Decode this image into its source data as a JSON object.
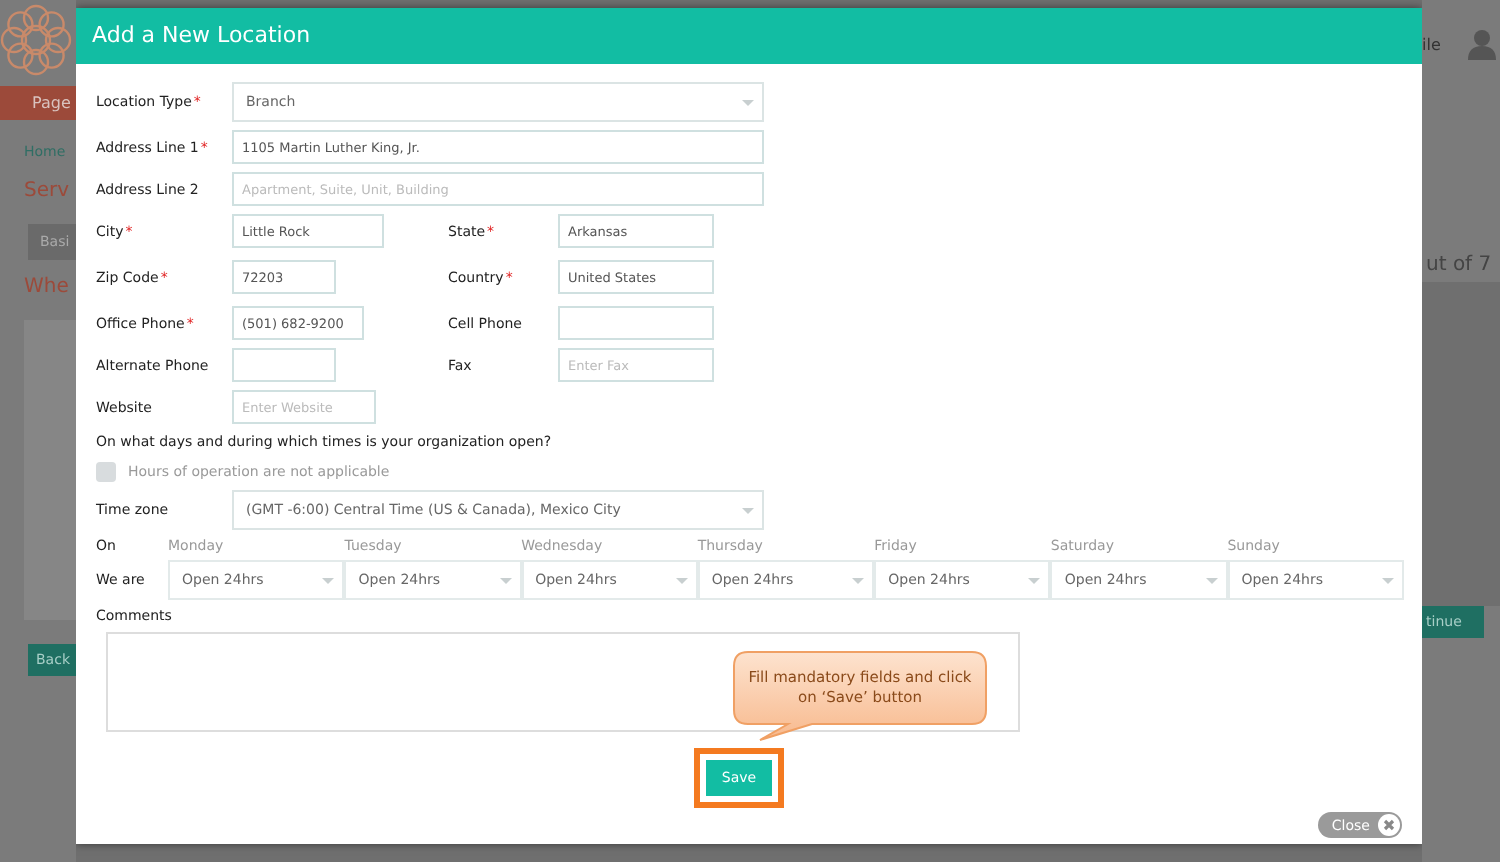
{
  "background": {
    "left": [
      {
        "kind": "logo"
      },
      {
        "kind": "red-button",
        "text": "Page"
      },
      {
        "kind": "link",
        "text": "Home"
      },
      {
        "kind": "heading",
        "text": "Serv"
      },
      {
        "kind": "tab",
        "text": "Basi"
      },
      {
        "kind": "heading",
        "text": "Whe"
      },
      {
        "kind": "panel"
      },
      {
        "kind": "teal-button",
        "text": "Back"
      }
    ],
    "right": [
      {
        "kind": "user",
        "text": "ile"
      },
      {
        "kind": "counter",
        "text": "ut of 7"
      },
      {
        "kind": "panel"
      },
      {
        "kind": "teal-button",
        "text": "tinue"
      }
    ]
  },
  "dialog": {
    "title": "Add a New Location",
    "wide_fields": [
      {
        "label": "Location Type",
        "required": true,
        "kind": "select",
        "value": "Branch"
      },
      {
        "label": "Address Line 1",
        "required": true,
        "kind": "text",
        "value": "1105 Martin Luther King, Jr."
      },
      {
        "label": "Address Line 2",
        "required": false,
        "kind": "text",
        "placeholder": "Apartment, Suite, Unit, Building"
      }
    ],
    "required_mark": "*",
    "pairs": [
      {
        "left": {
          "label": "City",
          "required": true,
          "value": "Little Rock"
        },
        "right": {
          "label": "State",
          "required": true,
          "value": "Arkansas"
        }
      },
      {
        "left": {
          "label": "Zip Code",
          "required": true,
          "value": "72203"
        },
        "right": {
          "label": "Country",
          "required": true,
          "value": "United States"
        }
      },
      {
        "left": {
          "label": "Office Phone",
          "required": true,
          "value": "(501) 682-9200"
        },
        "right": {
          "label": "Cell Phone",
          "required": false
        }
      },
      {
        "left": {
          "label": "Alternate Phone",
          "required": false
        },
        "right": {
          "label": "Fax",
          "required": false,
          "placeholder": "Enter Fax"
        }
      },
      {
        "left": {
          "label": "Website",
          "required": false,
          "placeholder": "Enter Website"
        }
      }
    ],
    "question": "On what days and during which times is your organization open?",
    "not_applicable": {
      "label": "Hours of operation are not applicable",
      "checked": false
    },
    "time_zone": {
      "label": "Time zone",
      "value": "(GMT -6:00) Central Time (US & Canada), Mexico City"
    },
    "schedule": {
      "on_label": "On",
      "we_are_label": "We are",
      "days": [
        {
          "day": "Monday",
          "value": "Open 24hrs"
        },
        {
          "day": "Tuesday",
          "value": "Open 24hrs"
        },
        {
          "day": "Wednesday",
          "value": "Open 24hrs"
        },
        {
          "day": "Thursday",
          "value": "Open 24hrs"
        },
        {
          "day": "Friday",
          "value": "Open 24hrs"
        },
        {
          "day": "Saturday",
          "value": "Open 24hrs"
        },
        {
          "day": "Sunday",
          "value": "Open 24hrs"
        }
      ]
    },
    "comments_label": "Comments",
    "callout": "Fill mandatory fields and click on ‘Save’ button",
    "save_button": "Save",
    "close_button": "Close"
  }
}
